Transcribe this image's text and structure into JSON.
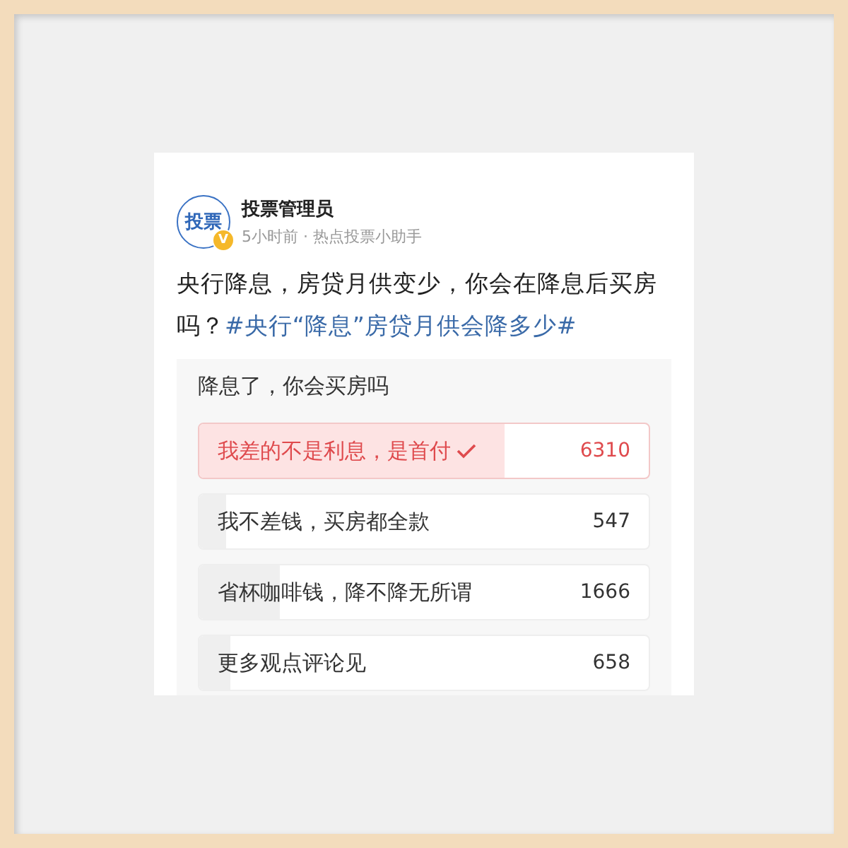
{
  "post": {
    "author": "投票管理员",
    "avatar_text": "投票",
    "badge": "V",
    "meta": "5小时前 · 热点投票小助手",
    "text": "央行降息，房贷月供变少，你会在降息后买房吗？",
    "hashtag": "#央行“降息”房贷月供会降多少#"
  },
  "poll": {
    "title": "降息了，你会买房吗",
    "options": [
      {
        "label": "我差的不是利息，是首付",
        "count": "6310",
        "level": 0.68,
        "selected": true
      },
      {
        "label": "我不差钱，买房都全款",
        "count": "547",
        "level": 0.06,
        "selected": false
      },
      {
        "label": "省杯咖啡钱，降不降无所谓",
        "count": "1666",
        "level": 0.18,
        "selected": false
      },
      {
        "label": "更多观点评论见",
        "count": "658",
        "level": 0.07,
        "selected": false
      }
    ]
  }
}
